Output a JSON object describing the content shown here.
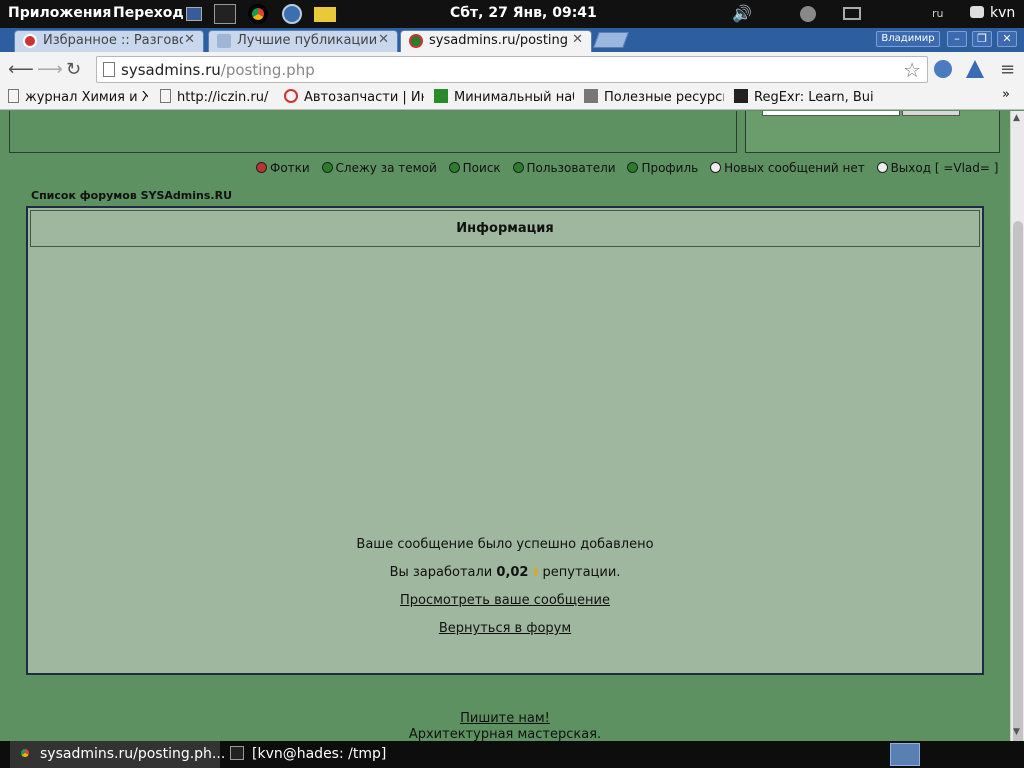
{
  "top_panel": {
    "applications": "Приложения",
    "places": "Переход",
    "clock": "Сбт, 27 Янв, 09:41",
    "lang": "ru",
    "user": "kvn",
    "icons": [
      "desktop-icon",
      "terminal-icon",
      "chrome-icon",
      "thunderbird-icon",
      "folder-icon",
      "volume-icon",
      "network-icon",
      "display-icon",
      "chat-icon"
    ]
  },
  "tabs": [
    {
      "title": "Избранное :: Разговор",
      "active": false
    },
    {
      "title": "Лучшие публикации",
      "active": false
    },
    {
      "title": "sysadmins.ru/posting",
      "active": true
    }
  ],
  "window": {
    "profile": "Владимир"
  },
  "omnibox": {
    "host": "sysadmins.ru",
    "path": "/posting.php"
  },
  "bookmarks": [
    "журнал Химия и Жизнь",
    "http://iczin.ru/",
    "Автозапчасти | Интернет",
    "Минимальный набор",
    "Полезные ресурсы",
    "RegExr: Learn, Build"
  ],
  "nav": {
    "photos": "Фотки",
    "watch": "Слежу за темой",
    "search": "Поиск",
    "users": "Пользователи",
    "profile": "Профиль",
    "messages": "Новых сообщений нет",
    "logout": "Выход [ =Vlad= ]"
  },
  "breadcrumb": "Список форумов SYSAdmins.RU",
  "info": {
    "header": "Информация",
    "success": "Ваше сообщение было успешно добавлено",
    "earned_prefix": "Вы заработали",
    "earned_value": "0,02",
    "earned_suffix": "репутации.",
    "view_link": "Просмотреть ваше сообщение",
    "back_link": "Вернуться в форум"
  },
  "footer": {
    "write_us": "Пишите нам!",
    "arch": "Архитектурная мастерская."
  },
  "taskbar": [
    {
      "title": "sysadmins.ru/posting.ph...",
      "active": true
    },
    {
      "title": "[kvn@hades: /tmp]",
      "active": false
    }
  ],
  "colors": {
    "page_bg": "#5e9161",
    "panel_bg": "#9fb79e",
    "tab_strip": "#2c5ea0"
  }
}
